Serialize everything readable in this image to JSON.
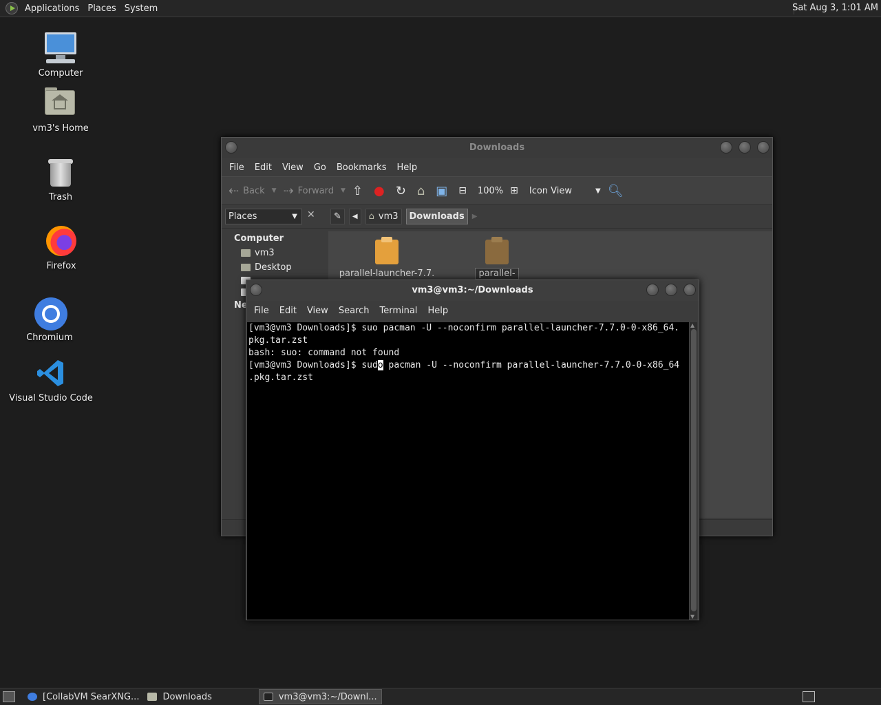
{
  "top_panel": {
    "menu": [
      "Applications",
      "Places",
      "System"
    ],
    "clock": "Sat Aug  3,  1:01 AM"
  },
  "desktop_icons": [
    {
      "label": "Computer",
      "icon": "computer-icon"
    },
    {
      "label": "vm3's Home",
      "icon": "home-folder-icon"
    },
    {
      "label": "Trash",
      "icon": "trash-icon"
    },
    {
      "label": "Firefox",
      "icon": "firefox-icon"
    },
    {
      "label": "Chromium",
      "icon": "chromium-icon"
    },
    {
      "label": "Visual Studio Code",
      "icon": "vscode-icon"
    }
  ],
  "file_manager": {
    "title": "Downloads",
    "menu": [
      "File",
      "Edit",
      "View",
      "Go",
      "Bookmarks",
      "Help"
    ],
    "toolbar": {
      "back": "Back",
      "forward": "Forward",
      "zoom": "100%",
      "view_mode": "Icon View"
    },
    "places_combo": "Places",
    "breadcrumb": [
      "vm3",
      "Downloads"
    ],
    "sidebar": {
      "section_computer": "Computer",
      "items": [
        "vm3",
        "Desktop"
      ],
      "section_network_partial": "Ne"
    },
    "files": [
      {
        "name": "parallel-launcher-7.7.",
        "selected": false
      },
      {
        "name": "parallel-",
        "selected": true
      }
    ]
  },
  "terminal": {
    "title": "vm3@vm3:~/Downloads",
    "menu": [
      "File",
      "Edit",
      "View",
      "Search",
      "Terminal",
      "Help"
    ],
    "lines": [
      "[vm3@vm3 Downloads]$ suo pacman -U --noconfirm parallel-launcher-7.7.0-0-x86_64.",
      "pkg.tar.zst",
      "bash: suo: command not found"
    ],
    "current_line_before_cursor": "[vm3@vm3 Downloads]$ sud",
    "cursor_char": "o",
    "current_line_after_cursor": " pacman -U --noconfirm parallel-launcher-7.7.0-0-x86_64",
    "current_line_wrap": ".pkg.tar.zst"
  },
  "taskbar": {
    "tasks": [
      {
        "label": "[CollabVM SearXNG...",
        "active": false
      },
      {
        "label": "Downloads",
        "active": false
      },
      {
        "label": "vm3@vm3:~/Downl...",
        "active": true
      }
    ]
  },
  "colors": {
    "desktop_bg": "#1d1d1d",
    "panel_bg": "#262626",
    "terminal_bg": "#000000",
    "window_bg": "#3c3c3c"
  }
}
